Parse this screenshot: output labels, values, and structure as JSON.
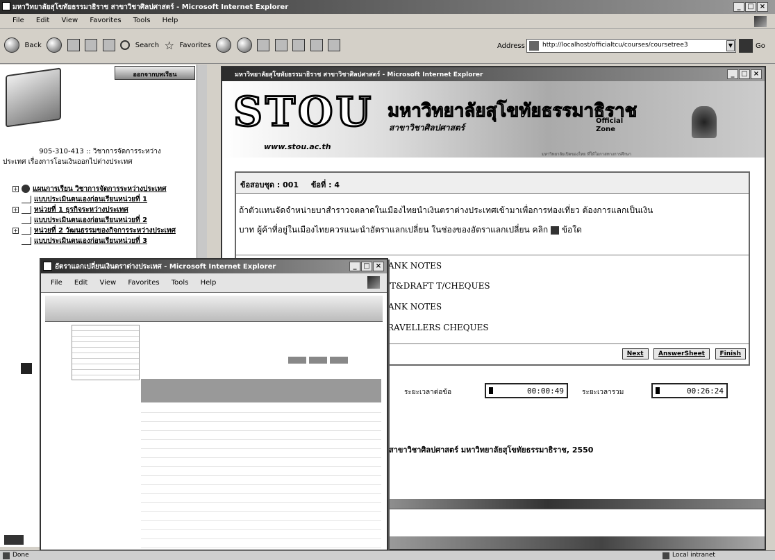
{
  "main_window": {
    "title": "มหาวิทยาลัยสุโขทัยธรรมาธิราช สาขาวิชาศิลปศาสตร์ - Microsoft Internet Explorer",
    "menu": [
      "File",
      "Edit",
      "View",
      "Favorites",
      "Tools",
      "Help"
    ],
    "toolbar": {
      "back": "Back",
      "search": "Search",
      "favorites": "Favorites"
    },
    "address_label": "Address",
    "address_value": "http://localhost/officialtcu/courses/coursetree3",
    "go_label": "Go",
    "status_text": "Done",
    "zone_text": "Local intranet"
  },
  "sidebar": {
    "exit_label": "ออกจากบทเรียน",
    "course_title_line1": "905-310-413 :: วิชาการจัดการระหว่าง",
    "course_title_line2": "ประเทศ เรื่องการโอนเงินออกไปต่างประเทศ",
    "items": [
      {
        "label": "แผนการเรียน วิชาการจัดการระหว่างประเทศ"
      },
      {
        "label": "แบบประเมินตนเองก่อนเรียนหน่วยที่ 1"
      },
      {
        "label": "หน่วยที่ 1 ธุรกิจระหว่างประเทศ"
      },
      {
        "label": "แบบประเมินตนเองก่อนเรียนหน่วยที่ 2"
      },
      {
        "label": "หน่วยที่ 2 วัฒนธรรมของกิจการระหว่างประเทศ"
      },
      {
        "label": "แบบประเมินตนเองก่อนเรียนหน่วยที่ 3"
      }
    ]
  },
  "exam_window": {
    "title": "มหาวิทยาลัยสุโขทัยธรรมาธิราช สาขาวิชาศิลปศาสตร์ - Microsoft Internet Explorer",
    "logo_text": "STOU",
    "logo_url": "www.stou.ac.th",
    "univ_name": "มหาวิทยาลัยสุโขทัยธรรมาธิราช",
    "dept_name": "สาขาวิชาศิลปศาสตร์",
    "official_zone": "Official Zone",
    "tagline": "มหาวิทยาลัยเปิดของไทย ที่ให้โอกาสทางการศึกษา",
    "exam_set_label": "ข้อสอบชุด : 001",
    "question_no_label": "ข้อที่ : 4",
    "question_line1": "ถ้าตัวแทนจัดจำหน่ายบาสำราวจตลาดในเมืองไทยนำเงินตราต่างประเทศเข้ามาเพื่อการท่องเที่ยว ต้องการแลกเป็นเงิน",
    "question_line2": "บาท ผู้ค้าที่อยู่ในเมืองไทยควรแนะนำอัตราแลกเปลี่ยน ในช่องของอัตราแลกเปลี่ยน คลิก",
    "question_tail": "ข้อใด",
    "choices": [
      "BANK NOTES",
      "T/T&DRAFT T/CHEQUES",
      "BANK NOTES",
      "TRAVELLERS CHEQUES"
    ],
    "buttons": {
      "next": "Next",
      "answer_sheet": "AnswerSheet",
      "finish": "Finish"
    },
    "timer_question_label": "ระยะเวลาต่อข้อ",
    "timer_question_value": "00:00:49",
    "timer_total_label": "ระยะเวลารวม",
    "timer_total_value": "00:26:24",
    "footer": "สาขาวิชาศิลปศาสตร์ มหาวิทยาลัยสุโขทัยธรรมาธิราช, 2550"
  },
  "popup_window": {
    "title": "อัตราแลกเปลี่ยนเงินตราต่างประเทศ - Microsoft Internet Explorer",
    "menu": [
      "File",
      "Edit",
      "View",
      "Favorites",
      "Tools",
      "Help"
    ]
  }
}
